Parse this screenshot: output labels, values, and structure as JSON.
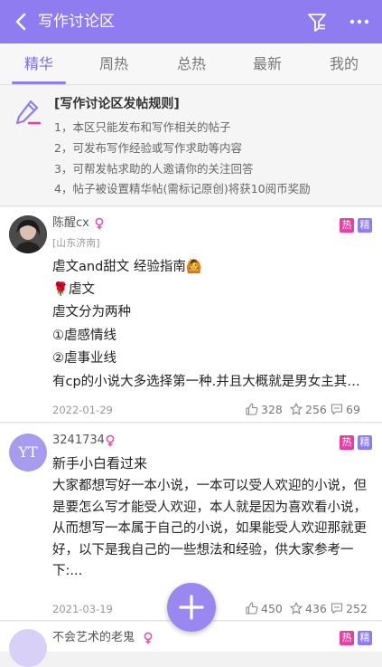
{
  "header": {
    "title": "写作讨论区"
  },
  "tabs": [
    {
      "label": "精华"
    },
    {
      "label": "周热"
    },
    {
      "label": "总热"
    },
    {
      "label": "最新"
    },
    {
      "label": "我的"
    }
  ],
  "rules": {
    "title": "[写作讨论区发帖规则]",
    "lines": [
      "1，本区只能发布和写作相关的帖子",
      "2，可发布写作经验或写作求助等内容",
      "3，可帮发帖求助的人邀请你的关注回答",
      "4，帖子被设置精华帖(需标记原创)将获10阅币奖励"
    ]
  },
  "posts": [
    {
      "username": "陈醒cx",
      "location": "[山东济南]",
      "badge_hot": "热",
      "badge_top": "精",
      "lines": [
        "虐文and甜文 经验指南🙆",
        "🌹虐文",
        "虐文分为两种",
        "①虐感情线",
        "②虐事业线",
        "有cp的小说大多选择第一种.并且大概就是男女主其…"
      ],
      "date": "2022-01-29",
      "likes": "328",
      "stars": "256",
      "comments": "69"
    },
    {
      "username": "3241734",
      "avatar_text": "YT",
      "badge_hot": "热",
      "badge_top": "精",
      "title": "新手小白看过来",
      "body": "大家都想写好一本小说，一本可以受人欢迎的小说，但是要怎么写才能受人欢迎，本人就是因为喜欢看小说，从而想写一本属于自己的小说，如果能受人欢迎那就更好，以下是我自己的一些想法和经验，供大家参考一下:...",
      "date": "2021-03-19",
      "likes": "450",
      "stars": "436",
      "comments": "252"
    },
    {
      "username": "不会艺术的老鬼",
      "badge_hot": "热",
      "badge_top": "精"
    }
  ],
  "colors": {
    "accent": "#8e7cf0",
    "hot": "#e53fa1",
    "gender": "#e055b0"
  },
  "icons": [
    "back-arrow-icon",
    "filter-icon",
    "more-icon",
    "pen-icon",
    "female-icon",
    "thumb-up-icon",
    "star-icon",
    "comment-icon",
    "plus-icon"
  ]
}
